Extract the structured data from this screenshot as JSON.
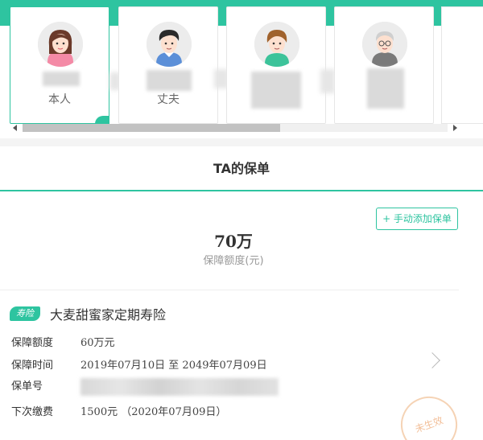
{
  "members": [
    {
      "relation": "本人"
    },
    {
      "relation": "丈夫"
    },
    {
      "relation": ""
    },
    {
      "relation": ""
    }
  ],
  "title": "TA的保单",
  "summary": {
    "add_button": "+ 手动添加保单",
    "total_amount": "70万",
    "total_label": "保障额度(元)"
  },
  "policy": {
    "tag": "寿险",
    "name": "大麦甜蜜家定期寿险",
    "coverage_label": "保障额度",
    "coverage_value": "60万元",
    "period_label": "保障时间",
    "period_value": "2019年07月10日  至  2049年07月09日",
    "policy_no_label": "保单号",
    "next_pay_label": "下次缴费",
    "next_pay_value": "1500元  （2020年07月09日）",
    "stamp_text": "未生效"
  },
  "colors": {
    "accent": "#2ec4a0",
    "text": "#333333",
    "muted": "#999999"
  }
}
